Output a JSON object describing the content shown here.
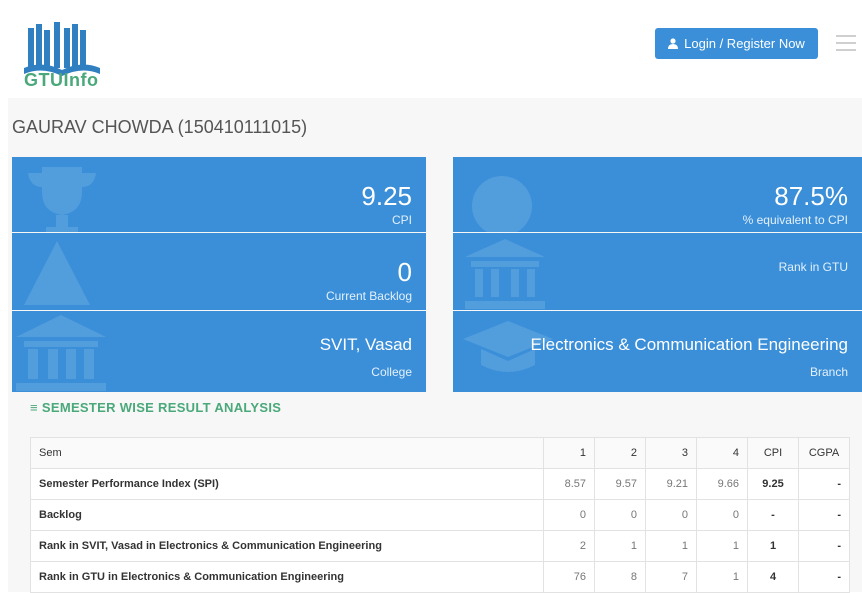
{
  "header": {
    "logo_text": "GTUInfo",
    "login_label": "Login / Register Now"
  },
  "student": {
    "name": "GAURAV CHOWDA (150410111015)"
  },
  "tiles": {
    "cpi": {
      "value": "9.25",
      "label": "CPI"
    },
    "percent": {
      "value": "87.5%",
      "label": "% equivalent to CPI"
    },
    "backlog": {
      "value": "0",
      "label": "Current Backlog"
    },
    "rank": {
      "value": "",
      "label": "Rank in GTU"
    },
    "college": {
      "value": "SVIT, Vasad",
      "label": "College"
    },
    "branch": {
      "value": "Electronics & Communication Engineering",
      "label": "Branch"
    }
  },
  "results": {
    "title": "SEMESTER WISE RESULT ANALYSIS",
    "headers": [
      "Sem",
      "1",
      "2",
      "3",
      "4",
      "CPI",
      "CGPA"
    ],
    "rows": [
      {
        "label": "Semester Performance Index (SPI)",
        "cells": [
          "8.57",
          "9.57",
          "9.21",
          "9.66",
          "9.25",
          "-"
        ]
      },
      {
        "label": "Backlog",
        "cells": [
          "0",
          "0",
          "0",
          "0",
          "-",
          "-"
        ]
      },
      {
        "label": "Rank in SVIT, Vasad in Electronics & Communication Engineering",
        "cells": [
          "2",
          "1",
          "1",
          "1",
          "1",
          "-"
        ]
      },
      {
        "label": "Rank in GTU in Electronics & Communication Engineering",
        "cells": [
          "76",
          "8",
          "7",
          "1",
          "4",
          "-"
        ]
      }
    ]
  },
  "colors": {
    "accent": "#3a8fd8",
    "brand_green": "#4aa87a"
  }
}
